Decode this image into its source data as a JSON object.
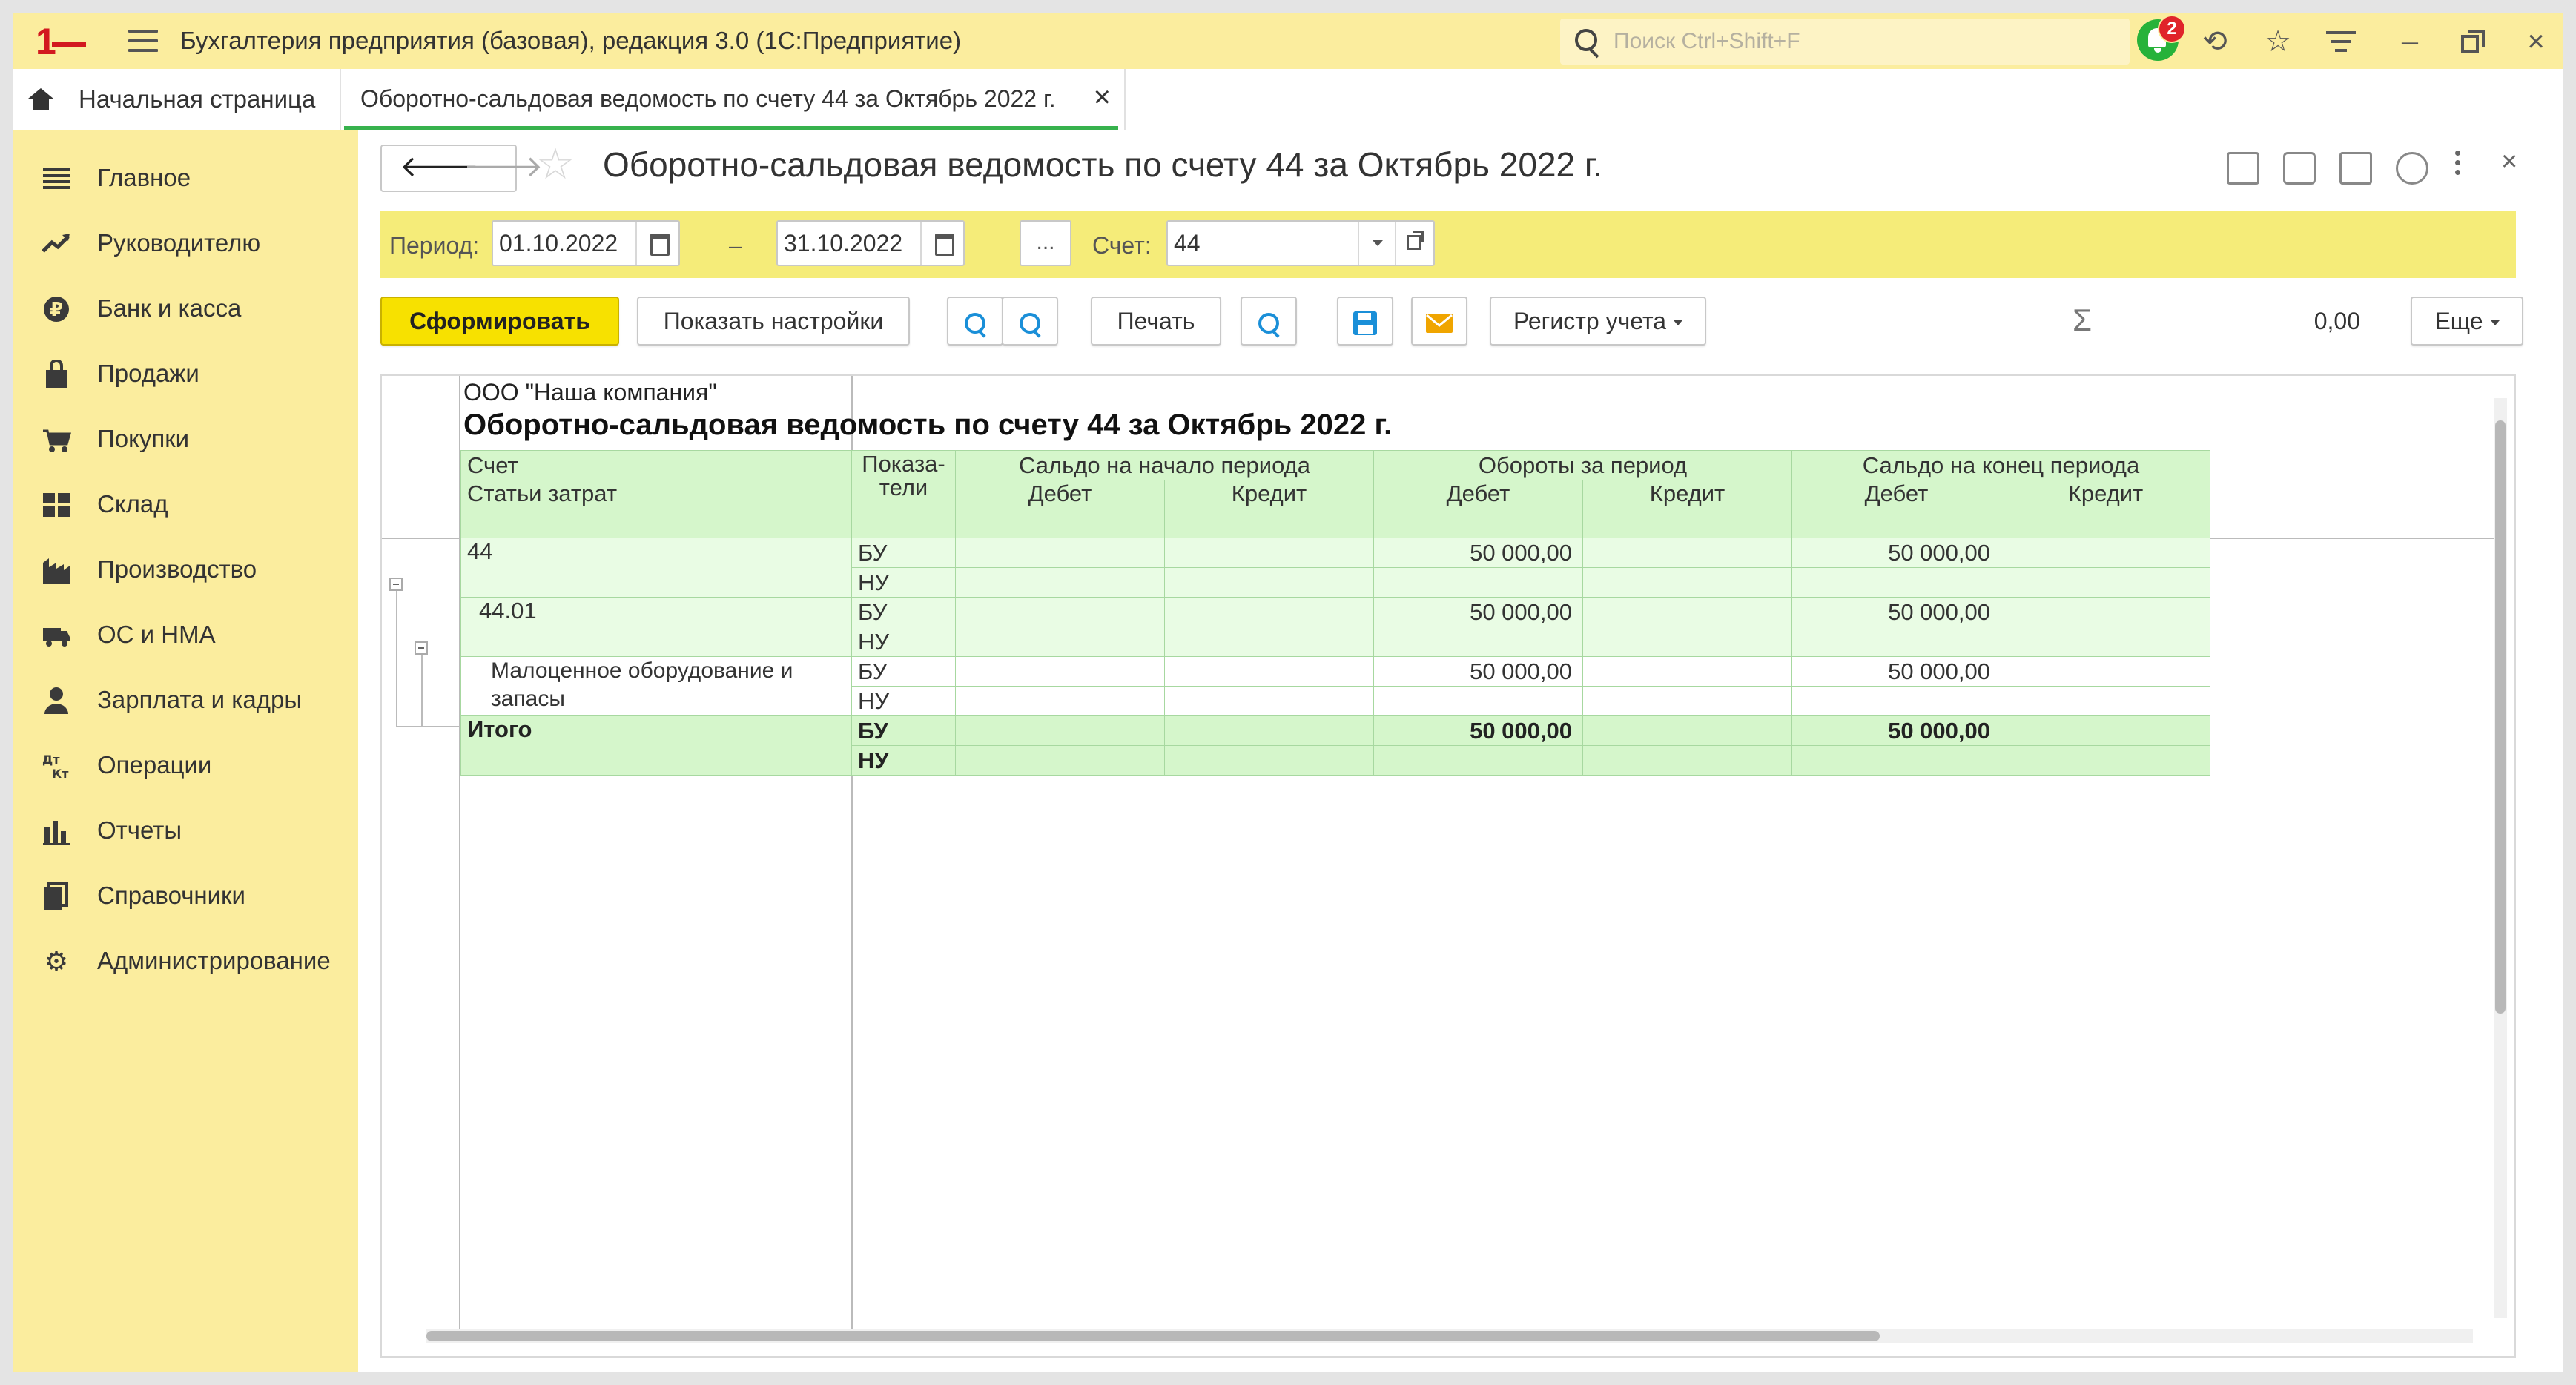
{
  "titlebar": {
    "app_title": "Бухгалтерия предприятия (базовая), редакция 3.0  (1С:Предприятие)",
    "search_placeholder": "Поиск Ctrl+Shift+F",
    "notifications_count": "2",
    "logo": "1С"
  },
  "tabs": {
    "home_label": "Начальная страница",
    "active_label": "Оборотно-сальдовая ведомость по счету 44 за Октябрь 2022 г.",
    "close_glyph": "×"
  },
  "sidebar": {
    "items": [
      {
        "label": "Главное",
        "icon": "menu-icon"
      },
      {
        "label": "Руководителю",
        "icon": "trend-icon"
      },
      {
        "label": "Банк и касса",
        "icon": "ruble-icon"
      },
      {
        "label": "Продажи",
        "icon": "bag-icon"
      },
      {
        "label": "Покупки",
        "icon": "cart-icon"
      },
      {
        "label": "Склад",
        "icon": "grid-icon"
      },
      {
        "label": "Производство",
        "icon": "factory-icon"
      },
      {
        "label": "ОС и НМА",
        "icon": "truck-icon"
      },
      {
        "label": "Зарплата и кадры",
        "icon": "person-icon"
      },
      {
        "label": "Операции",
        "icon": "dt-kt-icon"
      },
      {
        "label": "Отчеты",
        "icon": "bar-chart-icon"
      },
      {
        "label": "Справочники",
        "icon": "book-icon"
      },
      {
        "label": "Администрирование",
        "icon": "gear-icon"
      }
    ]
  },
  "document": {
    "title": "Оборотно-сальдовая ведомость по счету 44 за Октябрь 2022 г."
  },
  "period": {
    "label": "Период:",
    "from": "01.10.2022",
    "dash": "–",
    "to": "31.10.2022",
    "dots": "...",
    "account_label": "Счет:",
    "account_value": "44"
  },
  "commands": {
    "generate": "Сформировать",
    "show_settings": "Показать настройки",
    "print": "Печать",
    "register": "Регистр учета",
    "sum_value": "0,00",
    "more": "Еще"
  },
  "report": {
    "company": "ООО \"Наша компания\"",
    "title": "Оборотно-сальдовая ведомость по счету 44 за Октябрь 2022 г.",
    "headers": {
      "account": "Счет",
      "cost_items": "Статьи затрат",
      "indicators": "Показа-\nтели",
      "opening": "Сальдо на начало периода",
      "turnover": "Обороты за период",
      "closing": "Сальдо на конец периода",
      "debit": "Дебет",
      "credit": "Кредит"
    },
    "rows": [
      {
        "name": "44",
        "bu_label": "БУ",
        "nu_label": "НУ",
        "turn_debit": "50 000,00",
        "close_debit": "50 000,00"
      },
      {
        "name": "44.01",
        "bu_label": "БУ",
        "nu_label": "НУ",
        "turn_debit": "50 000,00",
        "close_debit": "50 000,00"
      },
      {
        "name": "Малоценное оборудование и запасы",
        "bu_label": "БУ",
        "nu_label": "НУ",
        "turn_debit": "50 000,00",
        "close_debit": "50 000,00"
      }
    ],
    "total": {
      "name": "Итого",
      "bu_label": "БУ",
      "nu_label": "НУ",
      "turn_debit": "50 000,00",
      "close_debit": "50 000,00"
    }
  }
}
